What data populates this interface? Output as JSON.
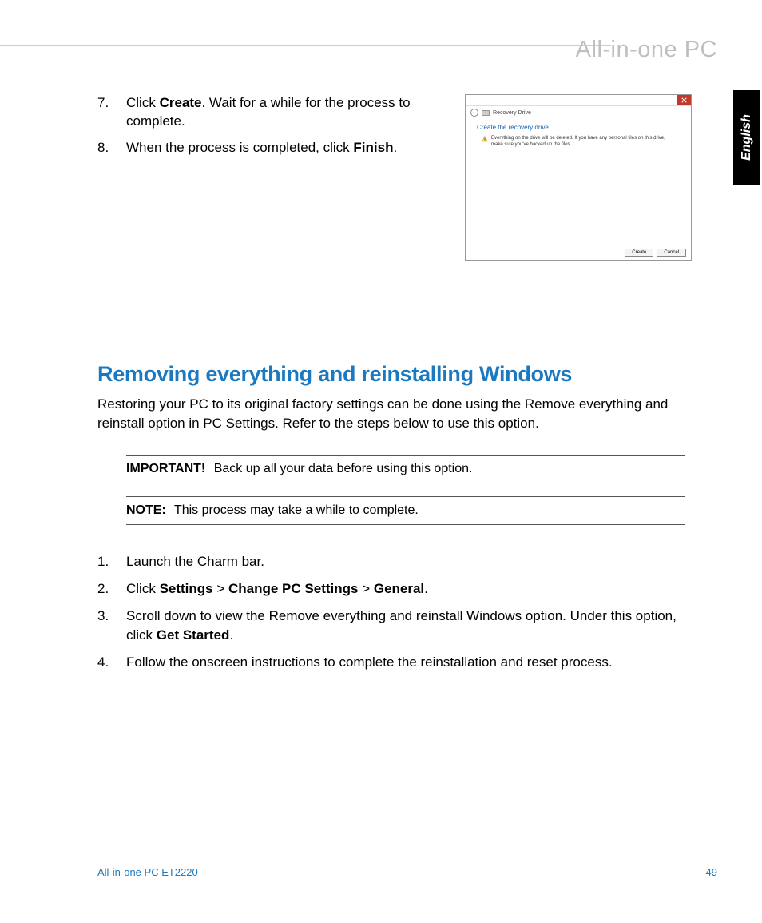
{
  "header": {
    "product_line": "All-in-one PC"
  },
  "language_tab": "English",
  "top_steps": [
    {
      "num": "7.",
      "pre": "Click ",
      "bold": "Create",
      "post": ". Wait for a while for the process to complete."
    },
    {
      "num": "8.",
      "pre": "When the process is completed, click ",
      "bold": "Finish",
      "post": "."
    }
  ],
  "screenshot": {
    "crumb": "Recovery Drive",
    "heading": "Create the recovery drive",
    "warning": "Everything on the drive will be deleted. If you have any personal files on this drive, make sure you've backed up the files.",
    "buttons": {
      "create": "Create",
      "cancel": "Cancel"
    }
  },
  "section": {
    "heading": "Removing everything and reinstalling Windows",
    "intro": "Restoring your PC to its original factory settings can be done using the Remove everything and reinstall option in PC Settings. Refer to the steps below to use this option."
  },
  "callouts": {
    "important": {
      "label": "IMPORTANT!",
      "text": "Back up all your data before using this option."
    },
    "note": {
      "label": "NOTE:",
      "text": "This process may take a while to complete."
    }
  },
  "lower_steps": {
    "s1": {
      "num": "1.",
      "text": "Launch the Charm bar."
    },
    "s2": {
      "num": "2.",
      "pre": "Click ",
      "b1": "Settings",
      "gt1": " > ",
      "b2": "Change PC Settings",
      "gt2": " > ",
      "b3": "General",
      "post": "."
    },
    "s3": {
      "num": "3.",
      "pre": "Scroll down to view the Remove everything and reinstall Windows option. Under this option, click ",
      "bold": "Get Started",
      "post": "."
    },
    "s4": {
      "num": "4.",
      "text": "Follow the onscreen instructions to complete the reinstallation and reset process."
    }
  },
  "footer": {
    "model": "All-in-one PC ET2220",
    "page": "49"
  }
}
